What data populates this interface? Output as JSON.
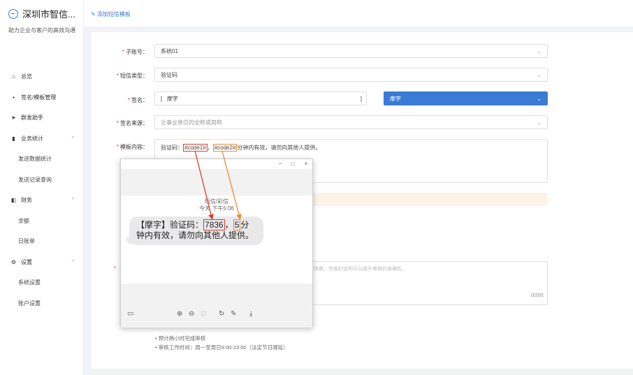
{
  "brand": {
    "title": "深圳市智信...",
    "subtitle": "助力企业与客户的高效沟通"
  },
  "breadcrumb": "添加短信模板",
  "menu": [
    {
      "label": "总览",
      "icon": "home-icon",
      "glyph": "⌂",
      "sub": false,
      "caret": ""
    },
    {
      "label": "签名/模板管理",
      "icon": "grid-icon",
      "glyph": "▪",
      "sub": false,
      "caret": ""
    },
    {
      "label": "群发助手",
      "icon": "send-icon",
      "glyph": "➤",
      "sub": false,
      "caret": ""
    },
    {
      "label": "业务统计",
      "icon": "bar-chart-icon",
      "glyph": "▮",
      "sub": false,
      "caret": "^"
    },
    {
      "label": "发送数据统计",
      "sub": true
    },
    {
      "label": "发送记录查询",
      "sub": true
    },
    {
      "label": "财务",
      "icon": "finance-icon",
      "glyph": "◧",
      "sub": false,
      "caret": "^"
    },
    {
      "label": "余额",
      "sub": true
    },
    {
      "label": "日账单",
      "sub": true
    },
    {
      "label": "设置",
      "icon": "gear-icon",
      "glyph": "⚙",
      "sub": false,
      "caret": "^"
    },
    {
      "label": "系统设置",
      "sub": true
    },
    {
      "label": "账户设置",
      "sub": true
    }
  ],
  "form": {
    "account_label": "子账号：",
    "account_value": "系统01",
    "type_label": "短信类型：",
    "type_value": "验证码",
    "sign_label": "签名：",
    "sign_input_prefix": "[",
    "sign_input_value": "摩字",
    "sign_input_suffix": "]",
    "sign_select_value": "摩字",
    "source_label": "签名来源：",
    "source_placeholder": "企事业单位的全称或简称",
    "content_label": "模板内容：",
    "content_prefix": "验证码：",
    "code1": "#code1#",
    "code_sep": "，",
    "code2": "#code2#",
    "content_suffix": "分钟内有效，请勿向其他人提供。",
    "desc_placeholder": "和发送场景。完善的说明可以提升审核的准确性。",
    "desc_counter": "0/200",
    "required_mark": "*"
  },
  "notes": [
    "预计两小时完成审核",
    "审核工作时间：周一至周日9:00-23:00（法定节日顺延）"
  ],
  "viewer": {
    "min": "−",
    "max": "□",
    "close": "×",
    "meta1": "短信/彩信",
    "meta2": "今天 下午5:06",
    "msg_prefix": "【摩字】验证码：",
    "msg_code1": "7836",
    "msg_sep": "，",
    "msg_code2": "5",
    "msg_line1_end": "分",
    "msg_line2": "钟内有效，请勿向其他人提供。",
    "tools": [
      "⊕",
      "⊖",
      "⊡",
      "↻",
      "✎",
      "⤓"
    ]
  },
  "colors": {
    "accent": "#3a7bd5",
    "highlight_red": "#e23a2e",
    "highlight_orange": "#f08a2a"
  }
}
